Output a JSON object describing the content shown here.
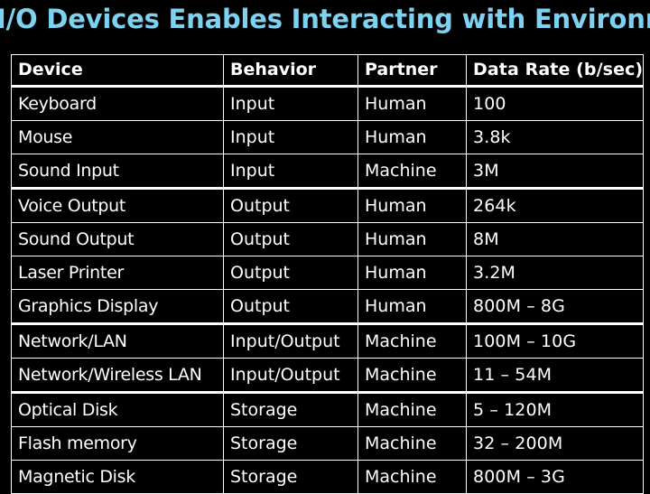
{
  "slide": {
    "title": "I/O Devices Enables Interacting with Environment",
    "title_color": "#7CD2F0",
    "background_color": "#000000",
    "text_color": "#FFFFFF"
  },
  "table": {
    "columns": [
      "Device",
      "Behavior",
      "Partner",
      "Data Rate (b/sec)"
    ],
    "rows": [
      {
        "device": "Keyboard",
        "behavior": "Input",
        "partner": "Human",
        "rate": "100",
        "group_end": false
      },
      {
        "device": "Mouse",
        "behavior": "Input",
        "partner": "Human",
        "rate": "3.8k",
        "group_end": false
      },
      {
        "device": "Sound Input",
        "behavior": "Input",
        "partner": "Machine",
        "rate": "3M",
        "group_end": true
      },
      {
        "device": "Voice Output",
        "behavior": "Output",
        "partner": "Human",
        "rate": "264k",
        "group_end": false
      },
      {
        "device": "Sound Output",
        "behavior": "Output",
        "partner": "Human",
        "rate": "8M",
        "group_end": false
      },
      {
        "device": "Laser Printer",
        "behavior": "Output",
        "partner": "Human",
        "rate": "3.2M",
        "group_end": false
      },
      {
        "device": "Graphics Display",
        "behavior": "Output",
        "partner": "Human",
        "rate": "800M – 8G",
        "group_end": true
      },
      {
        "device": "Network/LAN",
        "behavior": "Input/Output",
        "partner": "Machine",
        "rate": "100M – 10G",
        "group_end": false
      },
      {
        "device": "Network/Wireless LAN",
        "behavior": "Input/Output",
        "partner": "Machine",
        "rate": "11 – 54M",
        "group_end": true
      },
      {
        "device": "Optical Disk",
        "behavior": "Storage",
        "partner": "Machine",
        "rate": "5 – 120M",
        "group_end": false
      },
      {
        "device": "Flash memory",
        "behavior": "Storage",
        "partner": "Machine",
        "rate": "32 – 200M",
        "group_end": false
      },
      {
        "device": "Magnetic Disk",
        "behavior": "Storage",
        "partner": "Machine",
        "rate": "800M – 3G",
        "group_end": false
      }
    ]
  }
}
